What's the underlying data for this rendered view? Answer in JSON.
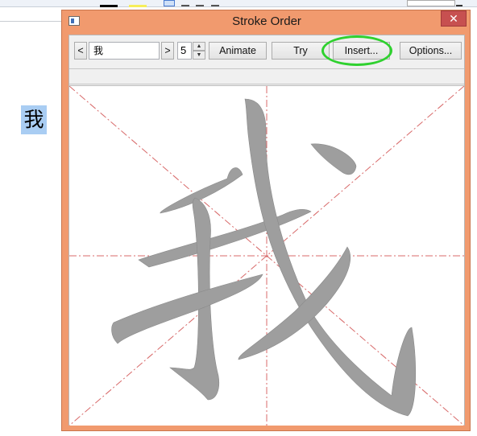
{
  "dialog": {
    "title": "Stroke Order",
    "close_symbol": "✕"
  },
  "document": {
    "selected_char": "我"
  },
  "toolbar": {
    "prev_label": "<",
    "next_label": ">",
    "char_value": "我",
    "count_value": "5",
    "spin_up": "▲",
    "spin_down": "▼",
    "animate_label": "Animate",
    "try_label": "Try",
    "insert_label": "Insert...",
    "options_label": "Options..."
  },
  "canvas": {
    "character": "我",
    "guide_color": "#d86a6a",
    "stroke_color": "#9e9e9e"
  },
  "colors": {
    "dialog_frame": "#f19a6e",
    "highlight_ring": "#2fd12f",
    "selection": "#a9cdf3"
  }
}
